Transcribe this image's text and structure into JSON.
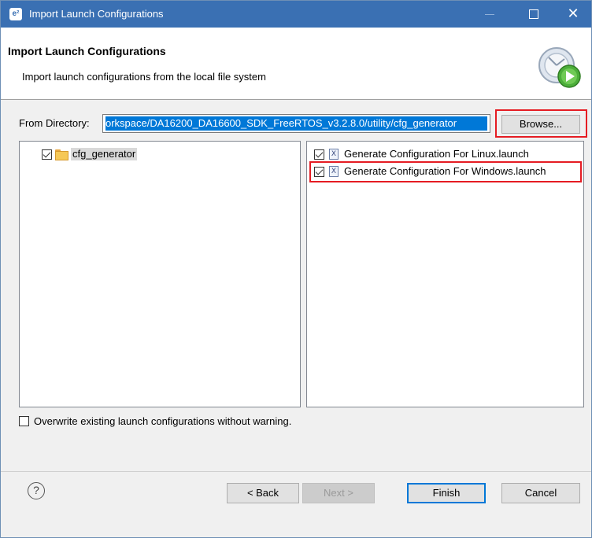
{
  "window": {
    "title": "Import Launch Configurations",
    "app_icon_text": "e²"
  },
  "banner": {
    "title": "Import Launch Configurations",
    "description": "Import launch configurations from the local file system"
  },
  "from_directory": {
    "label": "From Directory:",
    "value": "orkspace/DA16200_DA16600_SDK_FreeRTOS_v3.2.8.0/utility/cfg_generator",
    "browse_label": "Browse..."
  },
  "folder_tree": {
    "items": [
      {
        "label": "cfg_generator",
        "checked": true
      }
    ]
  },
  "file_list": {
    "items": [
      {
        "label": "Generate Configuration For Linux.launch",
        "checked": true
      },
      {
        "label": "Generate Configuration For Windows.launch",
        "checked": true
      }
    ]
  },
  "overwrite": {
    "label": "Overwrite existing launch configurations without warning.",
    "checked": false
  },
  "buttons": {
    "help": "?",
    "back": "< Back",
    "next": "Next >",
    "finish": "Finish",
    "cancel": "Cancel"
  },
  "colors": {
    "titlebar": "#3a70b3",
    "selection": "#0078d7",
    "highlight_box": "#e51c23"
  }
}
